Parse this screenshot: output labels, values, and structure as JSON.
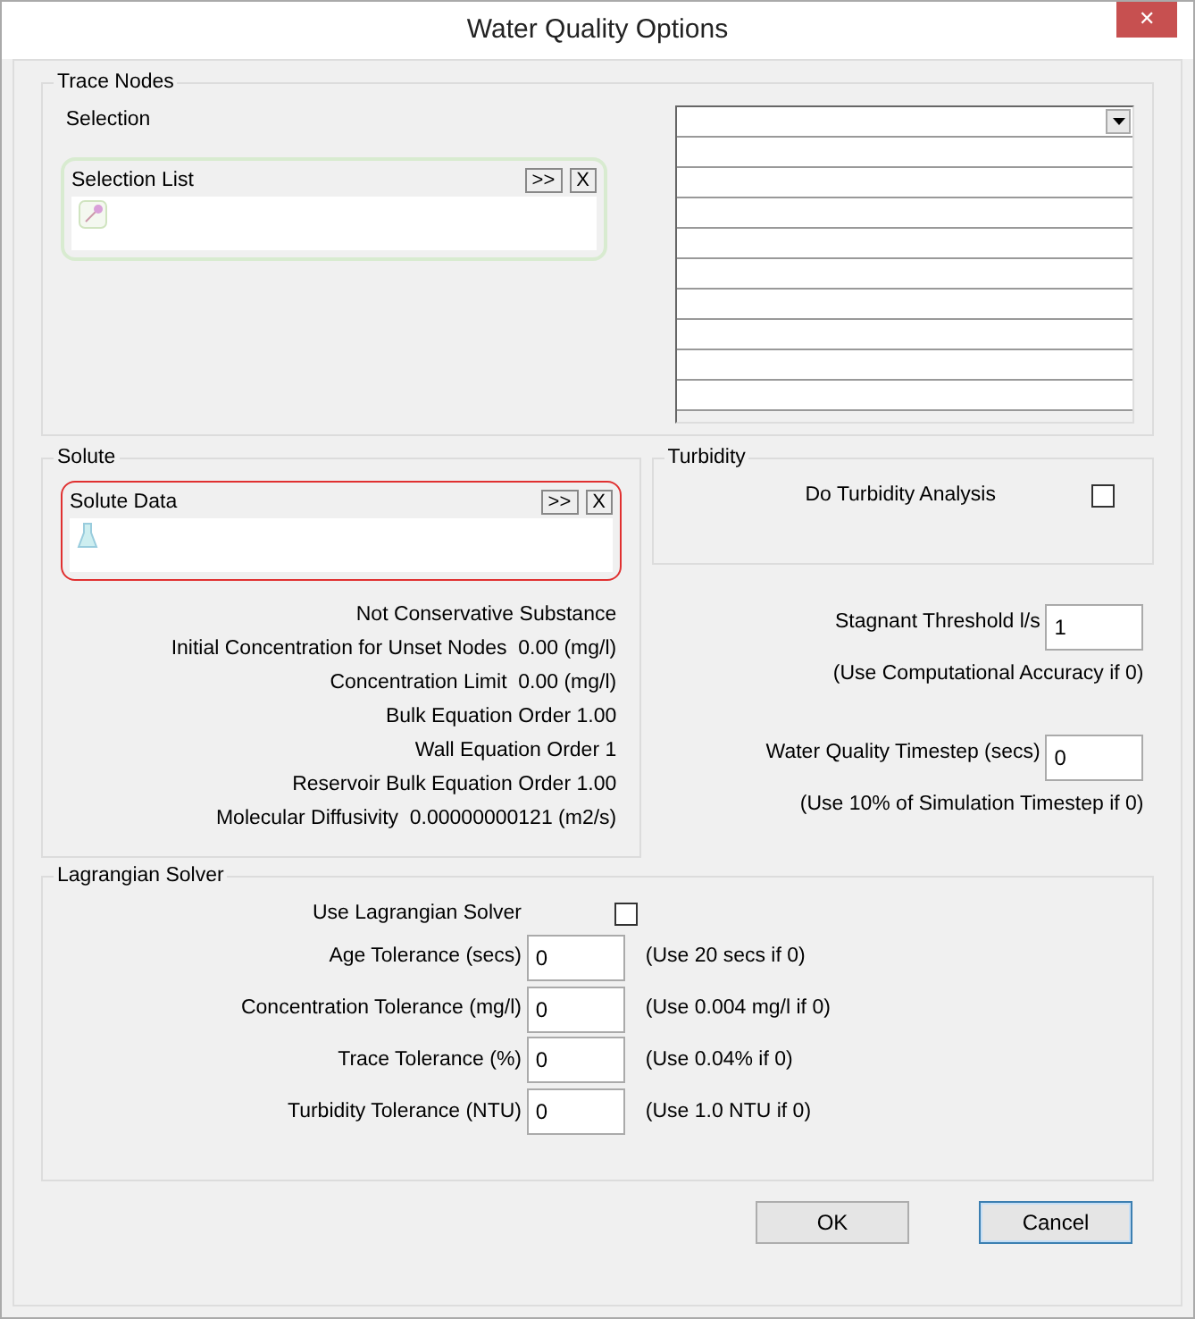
{
  "window": {
    "title": "Water Quality Options",
    "close": "✕"
  },
  "trace_nodes": {
    "legend": "Trace Nodes",
    "selection_label": "Selection",
    "selection_list": {
      "title": "Selection List",
      "add": ">>",
      "clear": "X"
    }
  },
  "solute": {
    "legend": "Solute",
    "data_panel": {
      "title": "Solute Data",
      "add": ">>",
      "clear": "X"
    },
    "lines": [
      "Not Conservative Substance",
      "Initial Concentration for Unset Nodes  0.00 (mg/l)",
      "Concentration Limit  0.00 (mg/l)",
      "Bulk Equation Order 1.00",
      "Wall Equation Order 1",
      "Reservoir Bulk Equation Order 1.00",
      "Molecular Diffusivity  0.00000000121 (m2/s)"
    ]
  },
  "turbidity": {
    "legend": "Turbidity",
    "label": "Do Turbidity Analysis",
    "checked": false
  },
  "settings": [
    {
      "label": "Stagnant Threshold l/s",
      "value": "1",
      "hint": "(Use Computational Accuracy if 0)"
    },
    {
      "label": "Water Quality Timestep (secs)",
      "value": "0",
      "hint": "(Use 10% of Simulation Timestep if 0)"
    }
  ],
  "lagrangian": {
    "legend": "Lagrangian Solver",
    "use_label": "Use Lagrangian Solver",
    "checked": false,
    "fields": [
      {
        "label": "Age Tolerance (secs)",
        "value": "0",
        "hint": "(Use 20 secs if 0)"
      },
      {
        "label": "Concentration Tolerance (mg/l)",
        "value": "0",
        "hint": "(Use 0.004 mg/l if 0)"
      },
      {
        "label": "Trace Tolerance (%)",
        "value": "0",
        "hint": "(Use 0.04% if 0)"
      },
      {
        "label": "Turbidity Tolerance (NTU)",
        "value": "0",
        "hint": "(Use 1.0 NTU if 0)"
      }
    ]
  },
  "buttons": [
    {
      "label": "OK",
      "selected": false
    },
    {
      "label": "Cancel",
      "selected": true
    }
  ]
}
